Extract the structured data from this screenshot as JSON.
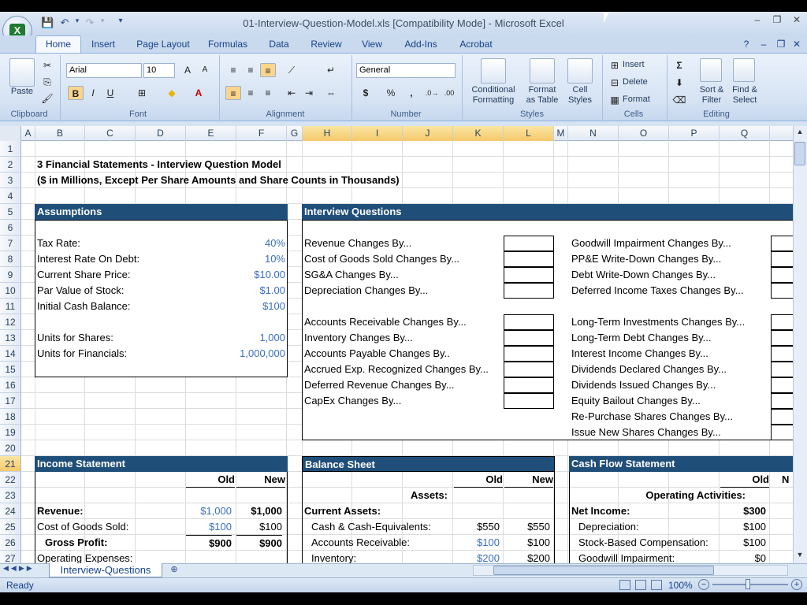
{
  "window": {
    "title": "01-Interview-Question-Model.xls  [Compatibility Mode] - Microsoft Excel",
    "app_icon_letter": "X"
  },
  "ribbon_tabs": [
    "Home",
    "Insert",
    "Page Layout",
    "Formulas",
    "Data",
    "Review",
    "View",
    "Add-Ins",
    "Acrobat"
  ],
  "active_tab": "Home",
  "ribbon": {
    "clipboard": {
      "label": "Clipboard",
      "paste": "Paste"
    },
    "font": {
      "label": "Font",
      "name": "Arial",
      "size": "10",
      "bold": "B",
      "italic": "I",
      "underline": "U"
    },
    "alignment": {
      "label": "Alignment"
    },
    "number": {
      "label": "Number",
      "format": "General",
      "currency": "$",
      "percent": "%",
      "comma": ","
    },
    "styles": {
      "label": "Styles",
      "conditional": "Conditional",
      "conditional2": "Formatting",
      "format_table": "Format",
      "format_table2": "as Table",
      "cell_styles": "Cell",
      "cell_styles2": "Styles"
    },
    "cells": {
      "label": "Cells",
      "insert": "Insert",
      "delete": "Delete",
      "format": "Format"
    },
    "editing": {
      "label": "Editing",
      "sort": "Sort &",
      "sort2": "Filter",
      "find": "Find &",
      "find2": "Select",
      "sigma": "Σ"
    }
  },
  "columns": [
    "A",
    "B",
    "C",
    "D",
    "E",
    "F",
    "G",
    "H",
    "I",
    "J",
    "K",
    "L",
    "M",
    "N",
    "O",
    "P",
    "Q"
  ],
  "rows": [
    "1",
    "2",
    "3",
    "4",
    "5",
    "6",
    "7",
    "8",
    "9",
    "10",
    "11",
    "12",
    "13",
    "14",
    "15",
    "16",
    "17",
    "18",
    "19",
    "20",
    "21",
    "22",
    "23",
    "24",
    "25",
    "26",
    "27"
  ],
  "sheet": {
    "title": "3 Financial Statements - Interview Question Model",
    "subtitle": "($ in Millions, Except Per Share Amounts and Share Counts in Thousands)",
    "assumptions": {
      "header": "Assumptions",
      "items": [
        {
          "label": "Tax Rate:",
          "value": "40%"
        },
        {
          "label": "Interest Rate On Debt:",
          "value": "10%"
        },
        {
          "label": "Current Share Price:",
          "value": "$10.00"
        },
        {
          "label": "Par Value of Stock:",
          "value": "$1.00"
        },
        {
          "label": "Initial Cash Balance:",
          "value": "$100"
        }
      ],
      "units": [
        {
          "label": "Units for Shares:",
          "value": "1,000"
        },
        {
          "label": "Units for Financials:",
          "value": "1,000,000"
        }
      ]
    },
    "questions": {
      "header": "Interview Questions",
      "left_group1": [
        "Revenue Changes By...",
        "Cost of Goods Sold Changes By...",
        "SG&A Changes By...",
        "Depreciation Changes By..."
      ],
      "left_group2": [
        "Accounts Receivable Changes By...",
        "Inventory Changes By...",
        "Accounts Payable Changes By..",
        "Accrued Exp. Recognized Changes By...",
        "Deferred Revenue Changes By...",
        "CapEx Changes By..."
      ],
      "right_group1": [
        "Goodwill Impairment Changes By...",
        "PP&E Write-Down Changes By...",
        "Debt Write-Down Changes By...",
        "Deferred Income Taxes Changes By..."
      ],
      "right_group2": [
        "Long-Term Investments Changes By...",
        "Long-Term Debt Changes By...",
        "Interest Income Changes By...",
        "Dividends Declared Changes By...",
        "Dividends Issued Changes By...",
        "Equity Bailout Changes By...",
        "Re-Purchase Shares Changes By...",
        "Issue New Shares Changes By..."
      ]
    },
    "income_statement": {
      "header": "Income Statement",
      "old": "Old",
      "new": "New",
      "rows": [
        {
          "label": "Revenue:",
          "old": "$1,000",
          "new": "$1,000"
        },
        {
          "label": "Cost of Goods Sold:",
          "old": "$100",
          "new": "$100"
        },
        {
          "label": "Gross Profit:",
          "old": "$900",
          "new": "$900"
        },
        {
          "label": "Operating Expenses:",
          "old": "",
          "new": ""
        }
      ]
    },
    "balance_sheet": {
      "header": "Balance Sheet",
      "old": "Old",
      "new": "New",
      "assets": "Assets:",
      "current_assets": "Current Assets:",
      "rows": [
        {
          "label": "Cash & Cash-Equivalents:",
          "old": "$550",
          "new": "$550"
        },
        {
          "label": "Accounts Receivable:",
          "old": "$100",
          "new": "$100"
        },
        {
          "label": "Inventory:",
          "old": "$200",
          "new": "$200"
        }
      ]
    },
    "cash_flow": {
      "header": "Cash Flow Statement",
      "old": "Old",
      "new": "N",
      "operating": "Operating Activities:",
      "rows": [
        {
          "label": "Net Income:",
          "old": "$300"
        },
        {
          "label": "Depreciation:",
          "old": "$100"
        },
        {
          "label": "Stock-Based Compensation:",
          "old": "$100"
        },
        {
          "label": "Goodwill Impairment:",
          "old": "$0"
        }
      ]
    }
  },
  "sheet_tab": "Interview-Questions",
  "status": {
    "ready": "Ready",
    "zoom": "100%"
  }
}
